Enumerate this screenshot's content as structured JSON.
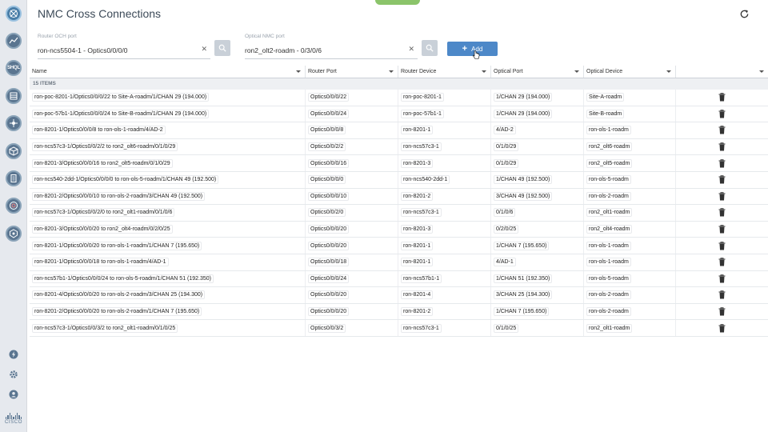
{
  "header": {
    "title": "NMC Cross Connections"
  },
  "filters": {
    "router_och": {
      "label": "Router OCH port",
      "value": "ron-ncs5504-1 - Optics0/0/0/0"
    },
    "optical_nmc": {
      "label": "Optical NMC port",
      "value": "ron2_olt2-roadm - 0/3/0/6"
    },
    "add_label": "Add"
  },
  "sidebar": {
    "top_icons": [
      "globe-icon",
      "chart-icon",
      "shql-icon",
      "device-icon",
      "routing-icon",
      "cube-icon",
      "document-icon",
      "target-icon",
      "shield-icon"
    ],
    "shql_text": "SHQL",
    "bottom_icons": [
      "lightning-icon",
      "gear-icon",
      "user-icon"
    ],
    "logo_text": "CISCO"
  },
  "table": {
    "columns": [
      "Name",
      "Router Port",
      "Router Device",
      "Optical Port",
      "Optical Device"
    ],
    "item_count": "15 ITEMS",
    "rows": [
      {
        "name": "ron-poc-8201-1/Optics0/0/0/22 to Site-A-roadm/1/CHAN 29 (194.000)",
        "router_port": "Optics0/0/0/22",
        "router_device": "ron-poc-8201-1",
        "optical_port": "1/CHAN 29 (194.000)",
        "optical_device": "Site-A-roadm"
      },
      {
        "name": "ron-poc-57b1-1/Optics0/0/0/24 to Site-B-roadm/1/CHAN 29 (194.000)",
        "router_port": "Optics0/0/0/24",
        "router_device": "ron-poc-57b1-1",
        "optical_port": "1/CHAN 29 (194.000)",
        "optical_device": "Site-B-roadm"
      },
      {
        "name": "ron-8201-1/Optics0/0/0/8 to ron-ols-1-roadm/4/AD-2",
        "router_port": "Optics0/0/0/8",
        "router_device": "ron-8201-1",
        "optical_port": "4/AD-2",
        "optical_device": "ron-ols-1-roadm"
      },
      {
        "name": "ron-ncs57c3-1/Optics0/0/2/2 to ron2_olt6-roadm/0/1/0/29",
        "router_port": "Optics0/0/2/2",
        "router_device": "ron-ncs57c3-1",
        "optical_port": "0/1/0/29",
        "optical_device": "ron2_olt6-roadm"
      },
      {
        "name": "ron-8201-3/Optics0/0/0/16 to ron2_olt5-roadm/0/1/0/29",
        "router_port": "Optics0/0/0/16",
        "router_device": "ron-8201-3",
        "optical_port": "0/1/0/29",
        "optical_device": "ron2_olt5-roadm"
      },
      {
        "name": "ron-ncs540-2dd-1/Optics0/0/0/0 to ron-ols-5-roadm/1/CHAN 49 (192.500)",
        "router_port": "Optics0/0/0/0",
        "router_device": "ron-ncs540-2dd-1",
        "optical_port": "1/CHAN 49 (192.500)",
        "optical_device": "ron-ols-5-roadm"
      },
      {
        "name": "ron-8201-2/Optics0/0/0/10 to ron-ols-2-roadm/3/CHAN 49 (192.500)",
        "router_port": "Optics0/0/0/10",
        "router_device": "ron-8201-2",
        "optical_port": "3/CHAN 49 (192.500)",
        "optical_device": "ron-ols-2-roadm"
      },
      {
        "name": "ron-ncs57c3-1/Optics0/0/2/0 to ron2_olt1-roadm/0/1/0/6",
        "router_port": "Optics0/0/2/0",
        "router_device": "ron-ncs57c3-1",
        "optical_port": "0/1/0/6",
        "optical_device": "ron2_olt1-roadm"
      },
      {
        "name": "ron-8201-3/Optics0/0/0/20 to ron2_olt4-roadm/0/2/0/25",
        "router_port": "Optics0/0/0/20",
        "router_device": "ron-8201-3",
        "optical_port": "0/2/0/25",
        "optical_device": "ron2_olt4-roadm"
      },
      {
        "name": "ron-8201-1/Optics0/0/0/20 to ron-ols-1-roadm/1/CHAN 7 (195.650)",
        "router_port": "Optics0/0/0/20",
        "router_device": "ron-8201-1",
        "optical_port": "1/CHAN 7 (195.650)",
        "optical_device": "ron-ols-1-roadm"
      },
      {
        "name": "ron-8201-1/Optics0/0/0/18 to ron-ols-1-roadm/4/AD-1",
        "router_port": "Optics0/0/0/18",
        "router_device": "ron-8201-1",
        "optical_port": "4/AD-1",
        "optical_device": "ron-ols-1-roadm"
      },
      {
        "name": "ron-ncs57b1-1/Optics0/0/0/24 to ron-ols-5-roadm/1/CHAN 51 (192.350)",
        "router_port": "Optics0/0/0/24",
        "router_device": "ron-ncs57b1-1",
        "optical_port": "1/CHAN 51 (192.350)",
        "optical_device": "ron-ols-5-roadm"
      },
      {
        "name": "ron-8201-4/Optics0/0/0/20 to ron-ols-2-roadm/3/CHAN 25 (194.300)",
        "router_port": "Optics0/0/0/20",
        "router_device": "ron-8201-4",
        "optical_port": "3/CHAN 25 (194.300)",
        "optical_device": "ron-ols-2-roadm"
      },
      {
        "name": "ron-8201-2/Optics0/0/0/20 to ron-ols-2-roadm/1/CHAN 7 (195.650)",
        "router_port": "Optics0/0/0/20",
        "router_device": "ron-8201-2",
        "optical_port": "1/CHAN 7 (195.650)",
        "optical_device": "ron-ols-2-roadm"
      },
      {
        "name": "ron-ncs57c3-1/Optics0/0/3/2 to ron2_olt1-roadm/0/1/0/25",
        "router_port": "Optics0/0/3/2",
        "router_device": "ron-ncs57c3-1",
        "optical_port": "0/1/0/25",
        "optical_device": "ron2_olt1-roadm"
      }
    ]
  },
  "colors": {
    "accent": "#4d88c8",
    "sidebar_bg": "#e6e9ee",
    "tab_green": "#8bc46a"
  }
}
